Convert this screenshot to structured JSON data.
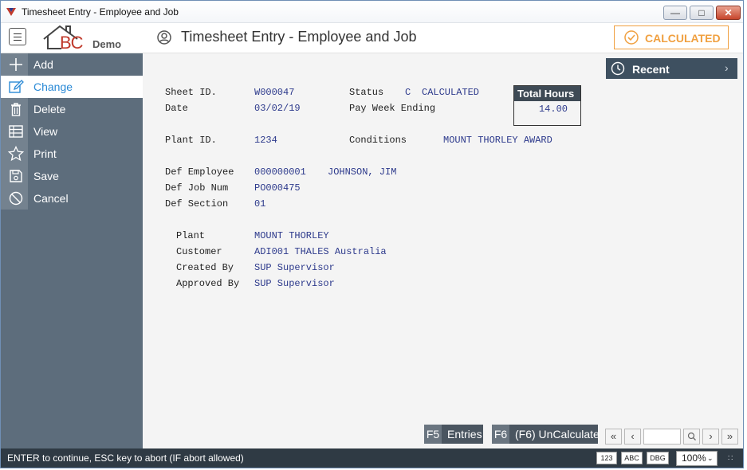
{
  "window": {
    "title": "Timesheet Entry - Employee and Job"
  },
  "header": {
    "logo_letters": "BC",
    "logo_suffix": "Demo",
    "page_title": "Timesheet Entry - Employee and Job",
    "status_badge": "CALCULATED",
    "accent_color": "#f0a040"
  },
  "sidebar": {
    "items": [
      {
        "label": "Add",
        "icon": "plus-icon"
      },
      {
        "label": "Change",
        "icon": "edit-icon",
        "active": true
      },
      {
        "label": "Delete",
        "icon": "trash-icon"
      },
      {
        "label": "View",
        "icon": "table-icon"
      },
      {
        "label": "Print",
        "icon": "star-icon"
      },
      {
        "label": "Save",
        "icon": "floppy-icon"
      },
      {
        "label": "Cancel",
        "icon": "cancel-icon"
      }
    ]
  },
  "recent": {
    "label": "Recent"
  },
  "form": {
    "sheet_id_label": "Sheet ID.",
    "sheet_id": "W000047",
    "date_label": "Date",
    "date": "03/02/19",
    "status_label": "Status",
    "status_code": "C",
    "status_text": "CALCULATED",
    "pay_week_label": "Pay Week Ending",
    "total_hours_label": "Total Hours",
    "total_hours": "14.00",
    "plant_id_label": "Plant ID.",
    "plant_id": "1234",
    "conditions_label": "Conditions",
    "conditions": "MOUNT THORLEY AWARD",
    "def_employee_label": "Def Employee",
    "def_employee": "000000001",
    "def_employee_name": "JOHNSON, JIM",
    "def_job_label": "Def Job Num",
    "def_job": "PO000475",
    "def_section_label": "Def Section",
    "def_section": "01",
    "plant_label": "Plant",
    "plant": "MOUNT THORLEY",
    "customer_label": "Customer",
    "customer": "ADI001 THALES Australia",
    "created_by_label": "Created By",
    "created_by": "SUP Supervisor",
    "approved_by_label": "Approved By",
    "approved_by": "SUP Supervisor"
  },
  "function_keys": [
    {
      "key": "F5",
      "label": "Entries"
    },
    {
      "key": "F6",
      "label": "(F6) UnCalculate"
    }
  ],
  "pager": {
    "first": "«",
    "prev": "‹",
    "next": "›",
    "last": "»",
    "page_value": ""
  },
  "statusbar": {
    "message": "ENTER to continue, ESC key to abort (IF abort allowed)",
    "btn_123": "123",
    "btn_abc": "ABC",
    "btn_dbg": "DBG",
    "zoom": "100%"
  }
}
